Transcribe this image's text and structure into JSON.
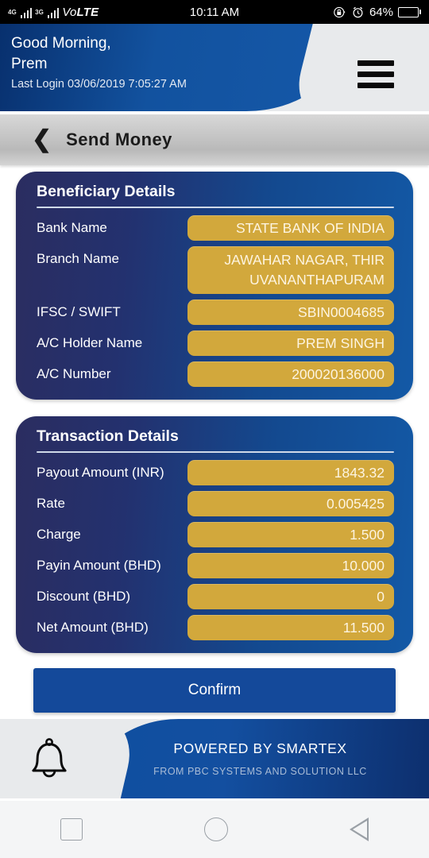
{
  "statusbar": {
    "network_4g": "4G",
    "network_3g": "3G",
    "volte_pre": "Vo",
    "volte_post": "LTE",
    "time": "10:11 AM",
    "battery_percent": "64%",
    "rotation_lock_icon": "rotation-lock-icon",
    "alarm_icon": "alarm-clock-icon"
  },
  "header": {
    "greeting": "Good Morning,",
    "user_name": "Prem",
    "last_login": "Last Login 03/06/2019 7:05:27 AM",
    "menu_icon": "hamburger-menu-icon"
  },
  "subheader": {
    "back_icon": "back-chevron-icon",
    "title": "Send Money"
  },
  "beneficiary": {
    "title": "Beneficiary Details",
    "rows": [
      {
        "label": "Bank Name",
        "value": "STATE BANK OF INDIA"
      },
      {
        "label": "Branch Name",
        "value": "JAWAHAR NAGAR, THIR UVANANTHAPURAM"
      },
      {
        "label": "IFSC / SWIFT",
        "value": "SBIN0004685"
      },
      {
        "label": "A/C Holder Name",
        "value": "PREM SINGH"
      },
      {
        "label": "A/C Number",
        "value": "200020136000"
      }
    ]
  },
  "transaction": {
    "title": "Transaction Details",
    "rows": [
      {
        "label": "Payout Amount (INR)",
        "value": "1843.32"
      },
      {
        "label": "Rate",
        "value": "0.005425"
      },
      {
        "label": "Charge",
        "value": "1.500"
      },
      {
        "label": "Payin Amount (BHD)",
        "value": "10.000"
      },
      {
        "label": "Discount (BHD)",
        "value": "0"
      },
      {
        "label": "Net Amount (BHD)",
        "value": "11.500"
      }
    ]
  },
  "actions": {
    "confirm_label": "Confirm"
  },
  "footer": {
    "powered_by": "POWERED BY SMARTEX",
    "company": "FROM PBC SYSTEMS AND SOLUTION LLC",
    "bell_icon": "bell-notification-icon"
  },
  "navbar": {
    "recents_icon": "square-recents-icon",
    "home_icon": "circle-home-icon",
    "back_icon": "triangle-back-icon"
  },
  "colors": {
    "gold": "#d2a83c",
    "card_navy": "#2b2d60",
    "card_blue": "#1359a6",
    "brand_blue": "#14499a",
    "battery_blue": "#2a9df4"
  }
}
